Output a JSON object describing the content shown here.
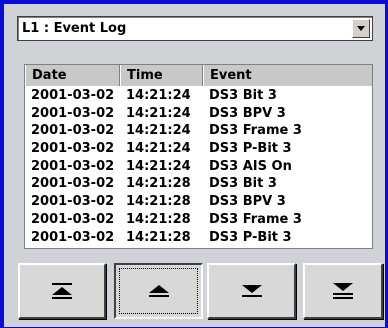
{
  "log_selector": {
    "value": "L1 : Event Log"
  },
  "columns": {
    "date": "Date",
    "time": "Time",
    "event": "Event"
  },
  "rows": [
    {
      "date": "2001-03-02",
      "time": "14:21:24",
      "event": "DS3 Bit 3"
    },
    {
      "date": "2001-03-02",
      "time": "14:21:24",
      "event": "DS3 BPV 3"
    },
    {
      "date": "2001-03-02",
      "time": "14:21:24",
      "event": "DS3 Frame 3"
    },
    {
      "date": "2001-03-02",
      "time": "14:21:24",
      "event": "DS3 P-Bit 3"
    },
    {
      "date": "2001-03-02",
      "time": "14:21:24",
      "event": "DS3 AIS On"
    },
    {
      "date": "2001-03-02",
      "time": "14:21:28",
      "event": "DS3 Bit 3"
    },
    {
      "date": "2001-03-02",
      "time": "14:21:28",
      "event": "DS3 BPV 3"
    },
    {
      "date": "2001-03-02",
      "time": "14:21:28",
      "event": "DS3 Frame 3"
    },
    {
      "date": "2001-03-02",
      "time": "14:21:28",
      "event": "DS3 P-Bit 3"
    }
  ],
  "nav_buttons": {
    "first": {
      "icon": "scroll-to-top-icon"
    },
    "prev": {
      "icon": "page-up-icon"
    },
    "next": {
      "icon": "page-down-icon"
    },
    "last": {
      "icon": "scroll-to-bottom-icon"
    }
  },
  "colors": {
    "frame": "#0b0bd8",
    "panel": "#cfd3d8",
    "header": "#c8c8c8"
  }
}
